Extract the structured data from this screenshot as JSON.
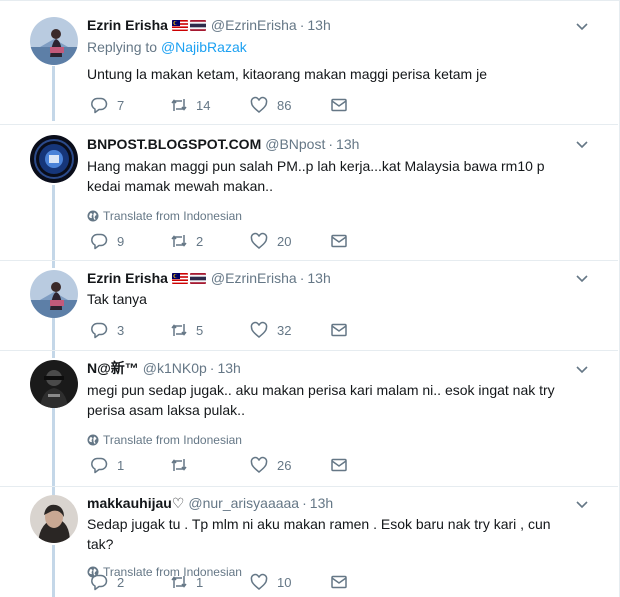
{
  "tweets": [
    {
      "name": "Ezrin Erisha",
      "flags": [
        "malaysia",
        "thailand"
      ],
      "handle": "@EzrinErisha",
      "time": "13h",
      "replying_prefix": "Replying to ",
      "replying_to": "@NajibRazak",
      "text": "Untung la makan ketam, kitaorang makan maggi perisa ketam je",
      "translate": "",
      "replies": "7",
      "retweets": "14",
      "likes": "86"
    },
    {
      "name": "BNPOST.BLOGSPOT.COM",
      "flags": [],
      "handle": "@BNpost",
      "time": "13h",
      "text": "Hang makan maggi pun salah PM..p lah kerja...kat Malaysia bawa rm10 p kedai mamak mewah makan..",
      "translate": "Translate from Indonesian",
      "replies": "9",
      "retweets": "2",
      "likes": "20"
    },
    {
      "name": "Ezrin Erisha",
      "flags": [
        "malaysia",
        "thailand"
      ],
      "handle": "@EzrinErisha",
      "time": "13h",
      "text": "Tak tanya",
      "translate": "",
      "replies": "3",
      "retweets": "5",
      "likes": "32"
    },
    {
      "name": "N@新™",
      "flags": [],
      "handle": "@k1NK0p",
      "time": "13h",
      "text": "megi pun sedap jugak.. aku makan perisa kari malam ni.. esok ingat nak try perisa asam laksa pulak..",
      "translate": "Translate from Indonesian",
      "replies": "1",
      "retweets": "",
      "likes": "26"
    },
    {
      "name": "makkauhijau♡",
      "flags": [],
      "handle": "@nur_arisyaaaaa",
      "time": "13h",
      "text": "Sedap jugak tu . Tp mlm ni aku makan ramen . Esok baru nak try kari , cun tak?",
      "translate": "Translate from Indonesian",
      "replies": "2",
      "retweets": "1",
      "likes": "10"
    }
  ],
  "icons": {
    "reply": "reply-icon",
    "retweet": "retweet-icon",
    "like": "heart-icon",
    "dm": "envelope-icon",
    "caret": "chevron-down-icon",
    "globe": "globe-icon"
  },
  "colors": {
    "link": "#1da1f2",
    "secondary": "#657786",
    "thread_line": "#c4d7e8",
    "border": "#e6ecf0"
  }
}
